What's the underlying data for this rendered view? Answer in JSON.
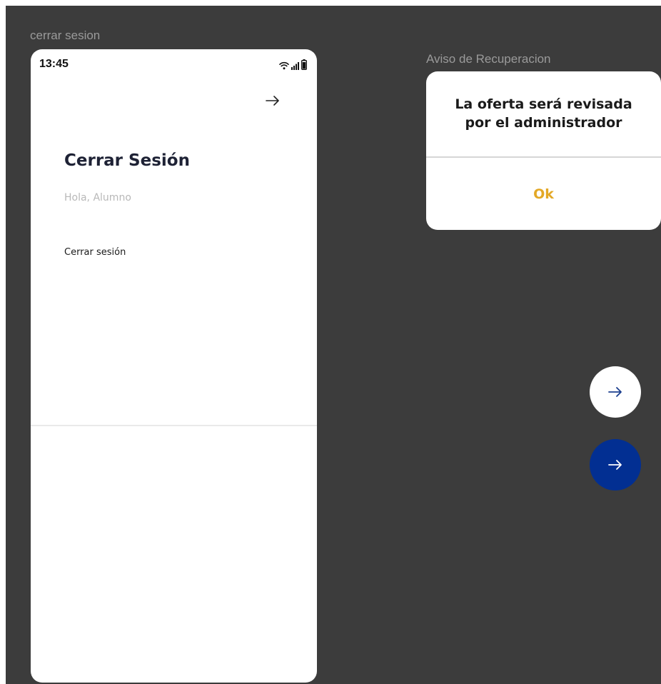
{
  "frames": {
    "left_label": "cerrar sesion",
    "right_label": "Aviso de Recuperacion"
  },
  "status_bar": {
    "time": "13:45",
    "icons": [
      "wifi-icon",
      "signal-icon",
      "battery-icon"
    ]
  },
  "logout_screen": {
    "nav_icon": "arrow-right-icon",
    "title": "Cerrar Sesión",
    "greeting": "Hola, Alumno",
    "logout_label": "Cerrar sesión"
  },
  "dialog": {
    "message_line1": "La oferta será revisada",
    "message_line2": "por el administrador",
    "ok_label": "Ok",
    "ok_color": "#e3a826"
  },
  "fab_buttons": [
    {
      "variant": "white",
      "icon": "arrow-right-icon",
      "background": "#ffffff",
      "icon_color": "#1c3f8f"
    },
    {
      "variant": "blue",
      "icon": "arrow-right-icon",
      "background": "#022f92",
      "icon_color": "#ffffff"
    }
  ],
  "colors": {
    "canvas_background": "#3c3c3c",
    "title_text": "#1e2235",
    "greeting_text": "#b8b8b8"
  }
}
